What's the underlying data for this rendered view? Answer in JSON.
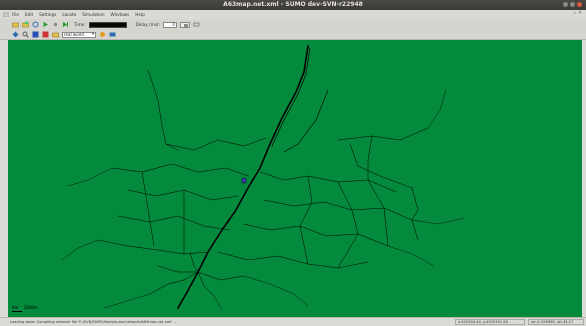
{
  "window": {
    "title": "A63map.net.xml - SUMO dev-SVN-r22948"
  },
  "menubar": {
    "items": [
      "File",
      "Edit",
      "Settings",
      "Locate",
      "Simulation",
      "Windows",
      "Help"
    ],
    "right_glyph": "= ✕"
  },
  "toolbar": {
    "time_label": "Time:",
    "delay_label": "Delay (ms):",
    "delay_value": "0"
  },
  "viewbar": {
    "scheme_value": "real world"
  },
  "canvas": {
    "background": "#038a3c",
    "road_color": "#000000",
    "scale_label": "0m",
    "scale_value": "1000m"
  },
  "status": {
    "message": "Loading done: Compiling network file 'E:/SVN/SUMO/tests/sumo/network/A63map.net.xml' ...",
    "coords": "x:420304.44, y:4920301.56",
    "coords2": "lon:1.026960, lat:44.21"
  },
  "colors": {
    "titlebar": "#3a3935",
    "chrome": "#dcdad5",
    "accent_close": "#d95c3a"
  }
}
